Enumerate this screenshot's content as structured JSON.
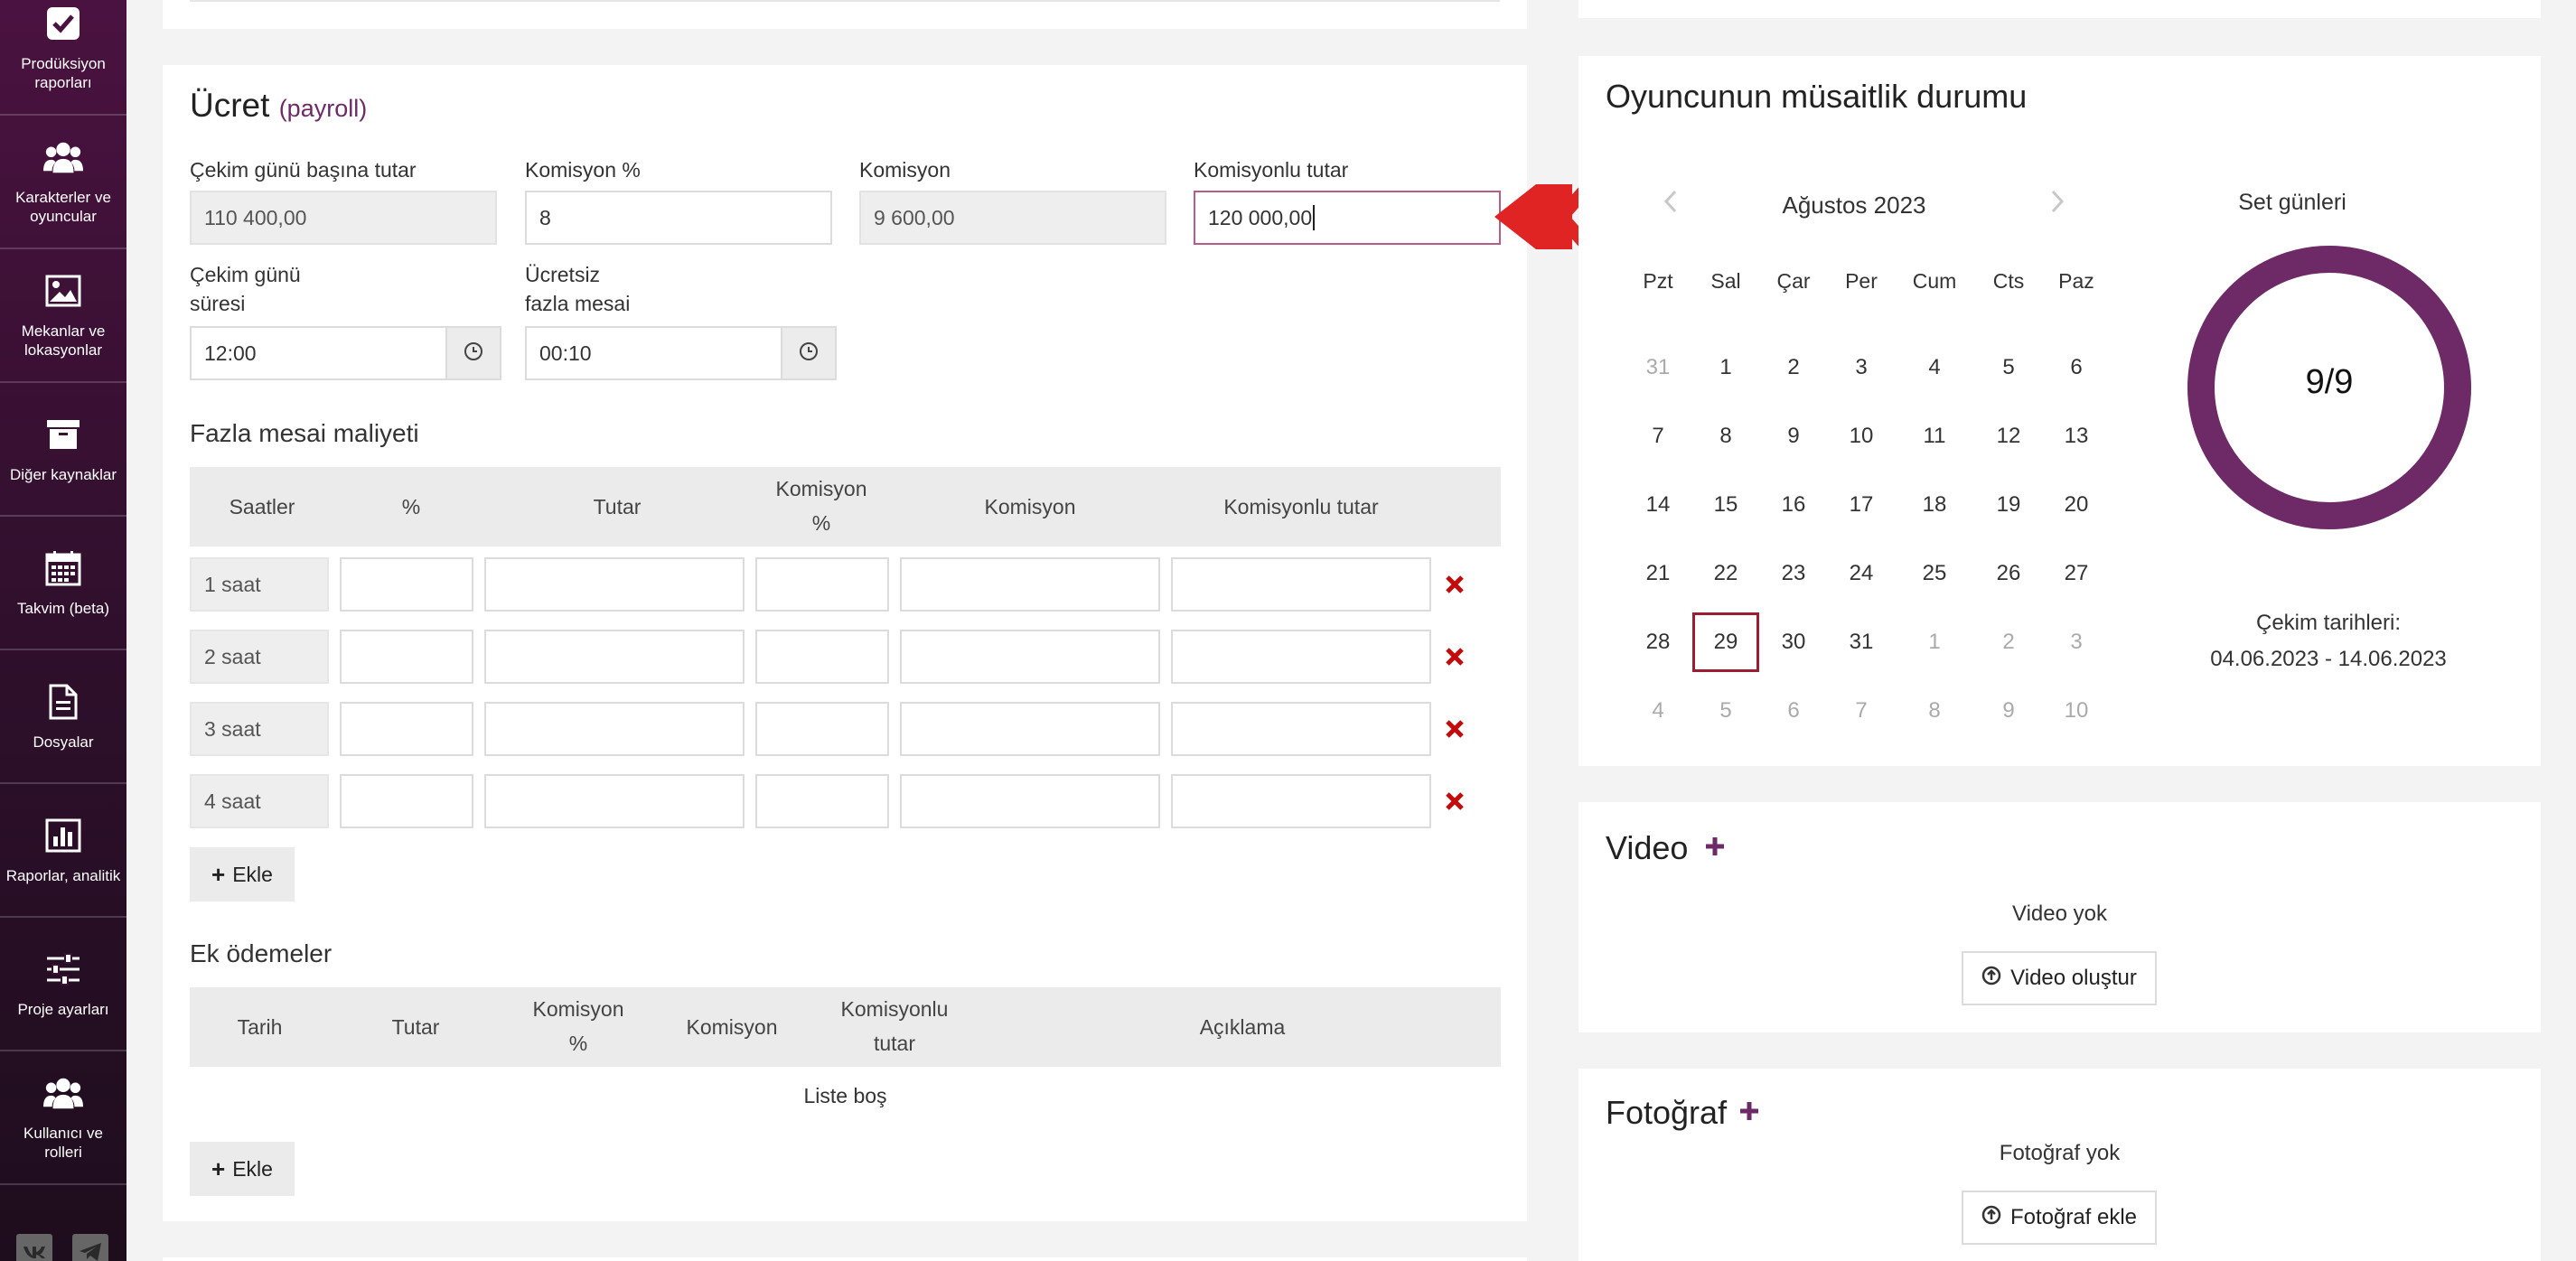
{
  "colors": {
    "brand": "#4a1240",
    "accent": "#6d2a67",
    "danger": "#c40a0a",
    "arrow": "#e02424",
    "ring": "#6d2a67"
  },
  "sidebar": {
    "items": [
      {
        "label": "Prodüksiyon raporları",
        "icon": "checkbox-icon"
      },
      {
        "label": "Karakterler ve oyuncular",
        "icon": "users-icon"
      },
      {
        "label": "Mekanlar ve lokasyonlar",
        "icon": "image-icon"
      },
      {
        "label": "Diğer kaynaklar",
        "icon": "archive-icon"
      },
      {
        "label": "Takvim (beta)",
        "icon": "calendar-icon"
      },
      {
        "label": "Dosyalar",
        "icon": "file-icon"
      },
      {
        "label": "Raporlar, analitik",
        "icon": "chart-icon"
      },
      {
        "label": "Proje ayarları",
        "icon": "sliders-icon"
      },
      {
        "label": "Kullanıcı ve rolleri",
        "icon": "users-icon"
      }
    ],
    "social": [
      "vk-icon",
      "telegram-icon"
    ]
  },
  "payroll": {
    "title": "Ücret",
    "subtitle": "(payroll)",
    "fields": {
      "per_day_label": "Çekim günü başına tutar",
      "per_day_value": "110 400,00",
      "commission_pct_label": "Komisyon %",
      "commission_pct_value": "8",
      "commission_label": "Komisyon",
      "commission_value": "9 600,00",
      "with_commission_label": "Komisyonlu tutar",
      "with_commission_value": "120 000,00",
      "duration_label_1": "Çekim günü",
      "duration_label_2": "süresi",
      "duration_value": "12:00",
      "free_overtime_label_1": "Ücretsiz",
      "free_overtime_label_2": "fazla mesai",
      "free_overtime_value": "00:10"
    },
    "overtime": {
      "title": "Fazla mesai maliyeti",
      "headers": {
        "hours": "Saatler",
        "pct": "%",
        "amount": "Tutar",
        "comm_pct_1": "Komisyon",
        "comm_pct_2": "%",
        "comm": "Komisyon",
        "with_comm": "Komisyonlu tutar"
      },
      "rows": [
        "1 saat",
        "2 saat",
        "3 saat",
        "4 saat"
      ],
      "add_label": "Ekle"
    },
    "extra": {
      "title": "Ek ödemeler",
      "headers": {
        "date": "Tarih",
        "amount": "Tutar",
        "comm_pct_1": "Komisyon",
        "comm_pct_2": "%",
        "comm": "Komisyon",
        "with_comm_1": "Komisyonlu",
        "with_comm_2": "tutar",
        "desc": "Açıklama"
      },
      "empty": "Liste boş",
      "add_label": "Ekle"
    }
  },
  "availability": {
    "title": "Oyuncunun müsaitlik durumu",
    "month": "Ağustos 2023",
    "weekdays": [
      "Pzt",
      "Sal",
      "Çar",
      "Per",
      "Cum",
      "Cts",
      "Paz"
    ],
    "weeks": [
      [
        "31",
        "1",
        "2",
        "3",
        "4",
        "5",
        "6"
      ],
      [
        "7",
        "8",
        "9",
        "10",
        "11",
        "12",
        "13"
      ],
      [
        "14",
        "15",
        "16",
        "17",
        "18",
        "19",
        "20"
      ],
      [
        "21",
        "22",
        "23",
        "24",
        "25",
        "26",
        "27"
      ],
      [
        "28",
        "29",
        "30",
        "31",
        "1",
        "2",
        "3"
      ],
      [
        "4",
        "5",
        "6",
        "7",
        "8",
        "9",
        "10"
      ]
    ],
    "selected_day": "29",
    "set_days_label": "Set günleri",
    "set_days_value": "9/9",
    "set_days_fraction": 1.0,
    "shoot_dates_label": "Çekim tarihleri:",
    "shoot_dates_value": "04.06.2023 - 14.06.2023"
  },
  "video": {
    "title": "Video",
    "empty": "Video yok",
    "button": "Video oluştur"
  },
  "photo": {
    "title": "Fotoğraf",
    "empty": "Fotoğraf yok",
    "button": "Fotoğraf ekle"
  }
}
